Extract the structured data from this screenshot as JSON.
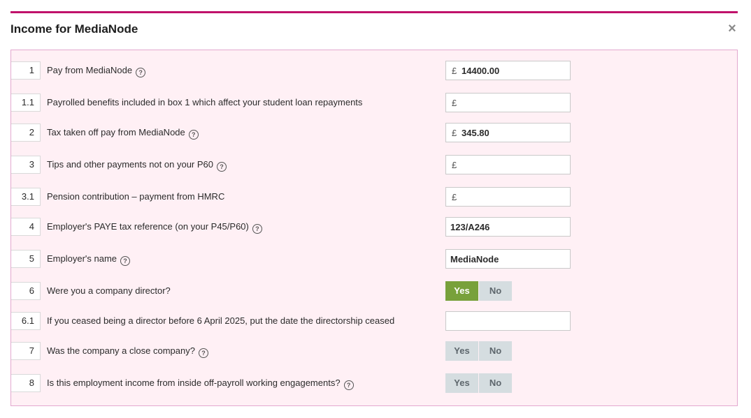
{
  "dialog": {
    "title": "Income for MediaNode",
    "close_glyph": "×"
  },
  "help_glyph": "?",
  "currency_symbol": "£",
  "rows": [
    {
      "number": "1",
      "label": "Pay from MediaNode",
      "value": "14400.00"
    },
    {
      "number": "1.1",
      "label": "Payrolled benefits included in box 1 which affect your student loan repayments",
      "value": ""
    },
    {
      "number": "2",
      "label": "Tax taken off pay from MediaNode",
      "value": "345.80"
    },
    {
      "number": "3",
      "label": "Tips and other payments not on your P60",
      "value": ""
    },
    {
      "number": "3.1",
      "label": "Pension contribution – payment from HMRC",
      "value": ""
    },
    {
      "number": "4",
      "label": "Employer's PAYE tax reference (on your P45/P60)",
      "value": "123/A246"
    },
    {
      "number": "5",
      "label": "Employer's name",
      "value": "MediaNode"
    },
    {
      "number": "6",
      "label": "Were you a company director?",
      "yes": "Yes",
      "no": "No",
      "selected": "Yes"
    },
    {
      "number": "6.1",
      "label": "If you ceased being a director before 6 April 2025, put the date the directorship ceased",
      "value": ""
    },
    {
      "number": "7",
      "label": "Was the company a close company?",
      "yes": "Yes",
      "no": "No",
      "selected": ""
    },
    {
      "number": "8",
      "label": "Is this employment income from inside off-payroll working engagements?",
      "yes": "Yes",
      "no": "No",
      "selected": ""
    }
  ]
}
